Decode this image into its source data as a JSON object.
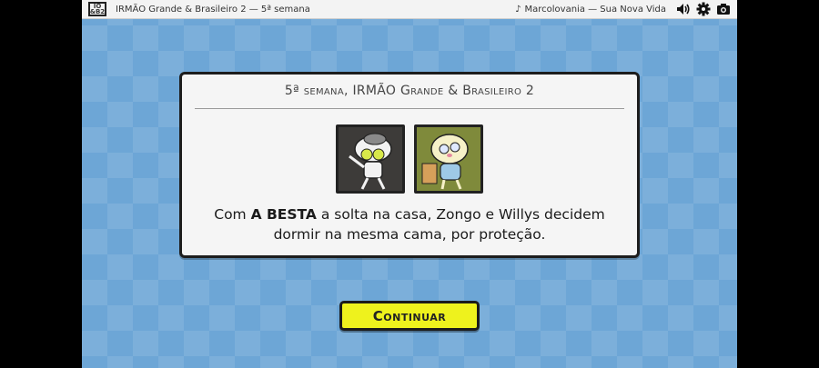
{
  "topbar": {
    "logo_top": "IO",
    "logo_bottom": "&B2",
    "title": "IRMÃO Grande & Brasileiro 2 — 5ª semana",
    "music_track": "Marcolovania — Sua Nova Vida",
    "icons": [
      "music-note-icon",
      "volume-icon",
      "gear-icon",
      "camera-icon"
    ]
  },
  "card": {
    "title": "5ª semana, IRMÃO Grande & Brasileiro 2",
    "portraits": [
      "portrait-a-besta",
      "portrait-zongo-willys"
    ],
    "text_prefix": "Com ",
    "text_bold": "A BESTA",
    "text_rest": " a solta na casa, Zongo e Willys decidem dormir na mesma cama, por proteção."
  },
  "continue_button": {
    "label": "Continuar",
    "color": "#eef21d"
  },
  "colors": {
    "background": "#6da6d6",
    "card": "#f5f5f5",
    "border": "#1d1d1d"
  }
}
